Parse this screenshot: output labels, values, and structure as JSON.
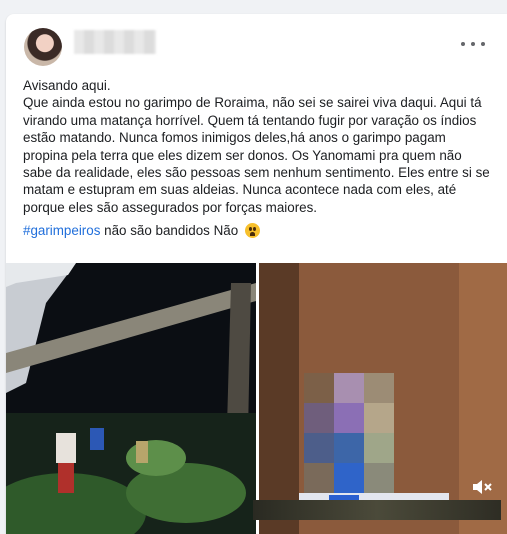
{
  "post": {
    "author_name": "",
    "menu_icon": "more-horizontal-icon",
    "lines": [
      "Avisando aqui.",
      "Que ainda estou no garimpo de Roraima, não sei se sairei viva daqui. Aqui tá virando uma matança horrível. Quem tá tentando fugir por varação os índios estão matando. Nunca fomos inimigos deles,há anos o garimpo pagam propina pela terra que eles dizem ser donos. Os Yanomami pra quem não sabe da realidade, eles são pessoas sem nenhum sentimento. Eles entre si se matam e estupram em suas aldeias. Nunca acontece nada com eles, até porque eles são assegurados por forças maiores."
    ],
    "hashtag": "#garimpeiros",
    "hashtag_suffix": " não são bandidos Não",
    "emoji": "crying-face-emoji"
  },
  "media": {
    "mute_icon": "speaker-muted-icon"
  }
}
